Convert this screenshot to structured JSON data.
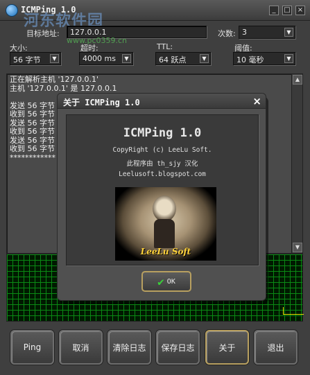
{
  "window": {
    "title": "ICMPing 1.0",
    "watermark": "河东软件园",
    "watermark_url": "www.pc0359.cn",
    "min_glyph": "_",
    "max_glyph": "□",
    "close_glyph": "×"
  },
  "settings": {
    "target_label": "目标地址:",
    "target_value": "127.0.0.1",
    "count_label": "次数:",
    "count_value": "3",
    "size_label": "大小:",
    "size_value": "56 字节",
    "timeout_label": "超时:",
    "timeout_value": "4000 ms",
    "ttl_label": "TTL:",
    "ttl_value": "64 跃点",
    "threshold_label": "阈值:",
    "threshold_value": "10 毫秒"
  },
  "log": {
    "lines": [
      "正在解析主机 '127.0.0.1'",
      "主机 '127.0.0.1' 是 127.0.0.1",
      "",
      "发送 56 字节",
      "收到 56 字节",
      "发送 56 字节",
      "收到 56 字节",
      "发送 56 字节",
      "收到 56 字节",
      "************"
    ]
  },
  "buttons": {
    "ping": "Ping",
    "cancel": "取消",
    "clear_log": "清除日志",
    "save_log": "保存日志",
    "about": "关于",
    "exit": "退出"
  },
  "about_dialog": {
    "title": "关于 ICMPing 1.0",
    "heading": "ICMPing 1.0",
    "copyright": "CopyRight (c) LeeLu Soft.",
    "localized_by": "此程序由 th_sjy 汉化",
    "website": "Leelusoft.blogspot.com",
    "photo_caption": "LeeLu Soft",
    "ok_label": "OK",
    "close_glyph": "×"
  },
  "colors": {
    "graph_grid": "#0a8a14",
    "graph_line": "#e8e800",
    "active_button_border": "#b8a060"
  }
}
